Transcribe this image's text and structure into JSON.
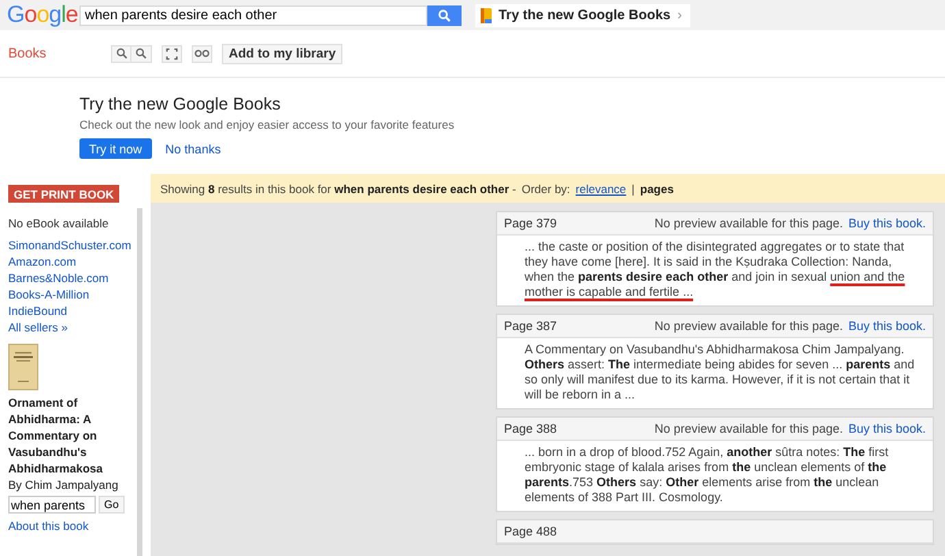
{
  "header": {
    "logo": "Google",
    "search": {
      "value": "when parents desire each other"
    },
    "promo_chip": {
      "label": "Try the new Google Books",
      "arrow": "›"
    }
  },
  "toolbar": {
    "section": "Books",
    "buttons": [
      {
        "kind": "zoom-in"
      },
      {
        "kind": "zoom-out"
      },
      {
        "kind": "fullscreen"
      },
      {
        "kind": "link"
      }
    ],
    "add_button": "Add to my library"
  },
  "promo": {
    "title": "Try the new Google Books",
    "description": "Check out the new look and enjoy easier access to your favorite features",
    "primary": "Try it now",
    "secondary": "No thanks"
  },
  "sidebar": {
    "print_button": "GET PRINT BOOK",
    "ebook_note": "No eBook available",
    "sellers": [
      "SimonandSchuster.com",
      "Amazon.com",
      "Barnes&Noble.com",
      "Books-A-Million",
      "IndieBound",
      "All sellers »"
    ],
    "book": {
      "title": "Ornament of Abhidharma: A Commentary on Vasubandhu's Abhidharmakosa",
      "author": "By Chim Jampalyang"
    },
    "search": {
      "value": "when parents"
    },
    "go_button": "Go",
    "about_link": "About this book"
  },
  "results_bar": {
    "summary": "Showing **8** results in this book for **when parents desire each other** -",
    "order_label": "Order by:",
    "separator": "|",
    "order_options": [
      {
        "label": "relevance",
        "selected": false
      },
      {
        "label": "pages",
        "selected": true
      }
    ]
  },
  "results": [
    {
      "page": "Page 379",
      "snippet": [
        {
          "text": "... the caste or position of the disintegrated aggregates or to state that they have come [here]. It is said in the Kṣudraka Collection: Nanda, when the **parents desire each other** and join in sexual ",
          "underlined": false
        },
        {
          "text": "union and the mother is capable and fertile ...",
          "underlined": true
        }
      ],
      "notice": "No preview available for this page.",
      "buy_link": "Buy this book."
    },
    {
      "page": "Page 387",
      "snippet": [
        {
          "text": "A Commentary on Vasubandhu's Abhidharmakosa Chim Jampalyang. **Others** assert: **The** intermediate being abides for seven ... **parents** and so only will manifest due to its karma. However, if it is not certain that it will be reborn in a ...",
          "underlined": false
        }
      ],
      "notice": "No preview available for this page.",
      "buy_link": "Buy this book."
    },
    {
      "page": "Page 388",
      "snippet": [
        {
          "text": "... born in a drop of blood.752 Again, **another** sûtra notes: **The** first embryonic stage of kalala arises from **the** unclean elements of **the parents**.753 **Others** say: **Other** elements arise from **the** unclean elements of 388 Part III. Cosmology.",
          "underlined": false
        }
      ],
      "notice": "No preview available for this page.",
      "buy_link": "Buy this book."
    },
    {
      "page": "Page 488"
    }
  ]
}
